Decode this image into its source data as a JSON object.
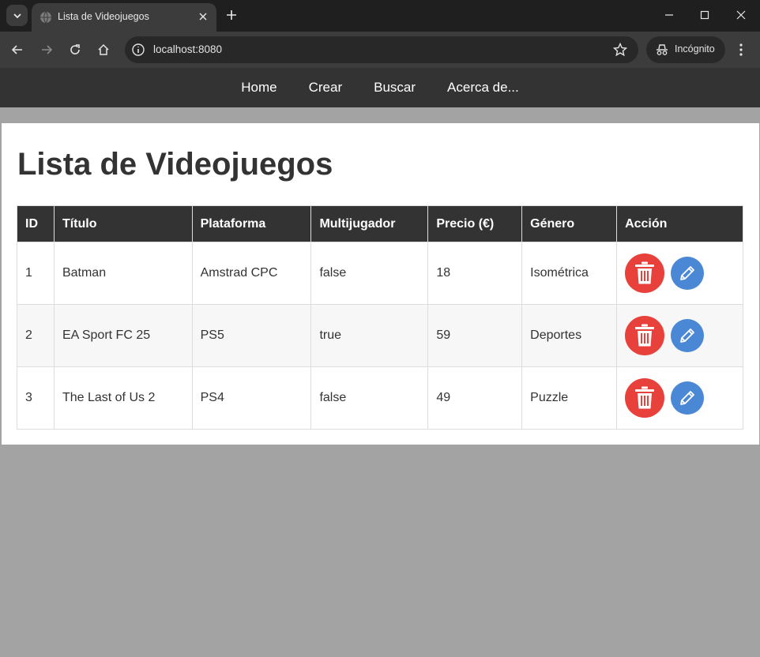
{
  "browser": {
    "tab_title": "Lista de Videojuegos",
    "url": "localhost:8080",
    "incognito_label": "Incógnito"
  },
  "nav": {
    "items": [
      "Home",
      "Crear",
      "Buscar",
      "Acerca de..."
    ]
  },
  "page": {
    "title": "Lista de Videojuegos"
  },
  "table": {
    "headers": [
      "ID",
      "Título",
      "Plataforma",
      "Multijugador",
      "Precio (€)",
      "Género",
      "Acción"
    ],
    "rows": [
      {
        "id": "1",
        "titulo": "Batman",
        "plataforma": "Amstrad CPC",
        "multijugador": "false",
        "precio": "18",
        "genero": "Isométrica"
      },
      {
        "id": "2",
        "titulo": "EA Sport FC 25",
        "plataforma": "PS5",
        "multijugador": "true",
        "precio": "59",
        "genero": "Deportes"
      },
      {
        "id": "3",
        "titulo": "The Last of Us 2",
        "plataforma": "PS4",
        "multijugador": "false",
        "precio": "49",
        "genero": "Puzzle"
      }
    ]
  },
  "colors": {
    "delete_button": "#e8403a",
    "edit_button": "#4a88d6",
    "header_bg": "#333333"
  }
}
